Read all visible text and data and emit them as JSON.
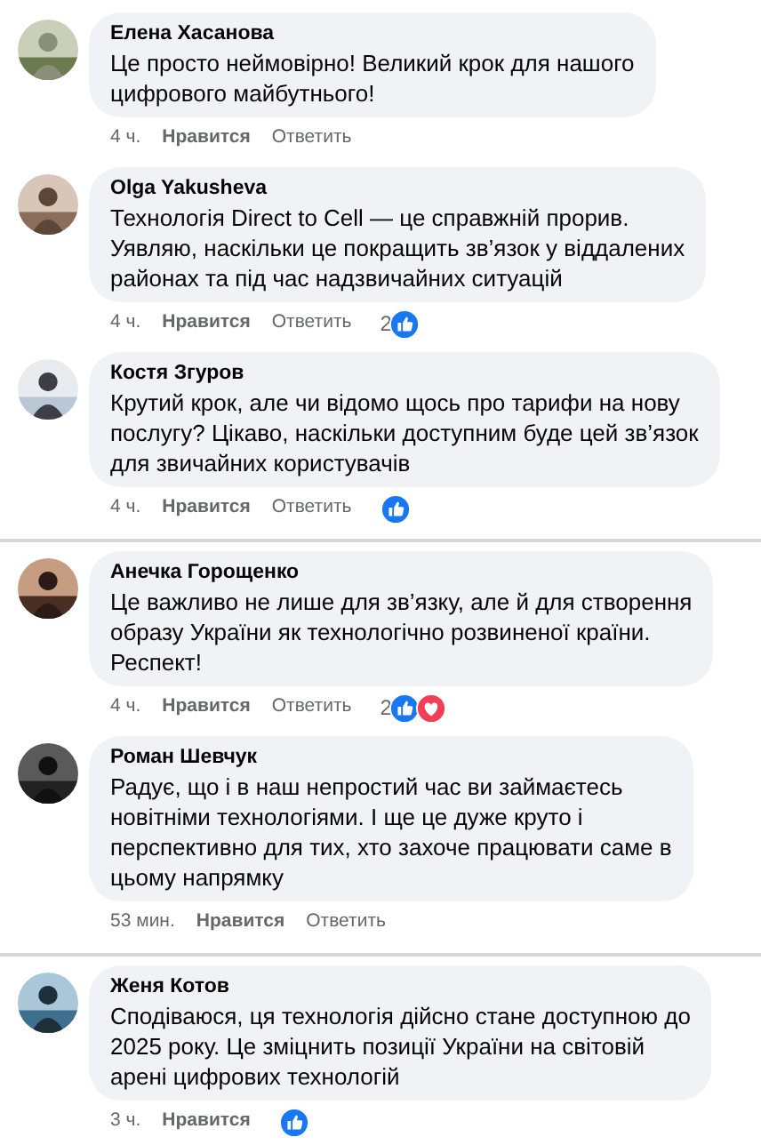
{
  "comments": [
    {
      "author": "Елена Хасанова",
      "text": "Це просто неймовірно! Великий крок для нашого\nцифрового майбутнього!",
      "time": "4 ч.",
      "like": "Нравится",
      "reply": "Ответить",
      "separator_after": false
    },
    {
      "author": "Olga Yakusheva",
      "text": "Технологія Direct to Cell — це справжній прорив.\nУявляю, наскільки це покращить зв’язок у віддалених\nрайонах та під час надзвичайних ситуацій",
      "time": "4 ч.",
      "like": "Нравится",
      "reply": "Ответить",
      "reaction_count": "2",
      "reactions": [
        {
          "kind": "like"
        }
      ],
      "separator_after": false
    },
    {
      "author": "Костя Згуров",
      "text": "Крутий крок, але чи відомо щось про тарифи на нову\nпослугу? Цікаво, наскільки доступним буде цей зв’язок\nдля звичайних користувачів",
      "time": "4 ч.",
      "like": "Нравится",
      "reply": "Ответить",
      "reactions": [
        {
          "kind": "like"
        }
      ],
      "separator_after": true
    },
    {
      "author": "Анечка Горощенко",
      "text": "Це важливо не лише для зв’язку, але й для створення\nобразу України як технологічно розвиненої країни.\nРеспект!",
      "time": "4 ч.",
      "like": "Нравится",
      "reply": "Ответить",
      "reaction_count": "2",
      "reactions": [
        {
          "kind": "like"
        },
        {
          "kind": "love"
        }
      ],
      "separator_after": false
    },
    {
      "author": "Роман Шевчук",
      "text": "Радує, що і в наш непростий час ви займаєтесь\nновітніми технологіями. І ще це дуже круто і\nперспективно для тих, хто захоче працювати саме в\nцьому напрямку",
      "time": "53 мин.",
      "like": "Нравится",
      "reply": "Ответить",
      "separator_after": true
    },
    {
      "author": "Женя Котов",
      "text": "Сподіваюся, ця технологія дійсно стане доступною до\n2025 року. Це зміцнить позиції України на світовій\nарені цифрових технологій",
      "time": "3 ч.",
      "like": "Нравится",
      "reactions": [
        {
          "kind": "like"
        }
      ],
      "separator_after": false
    }
  ]
}
